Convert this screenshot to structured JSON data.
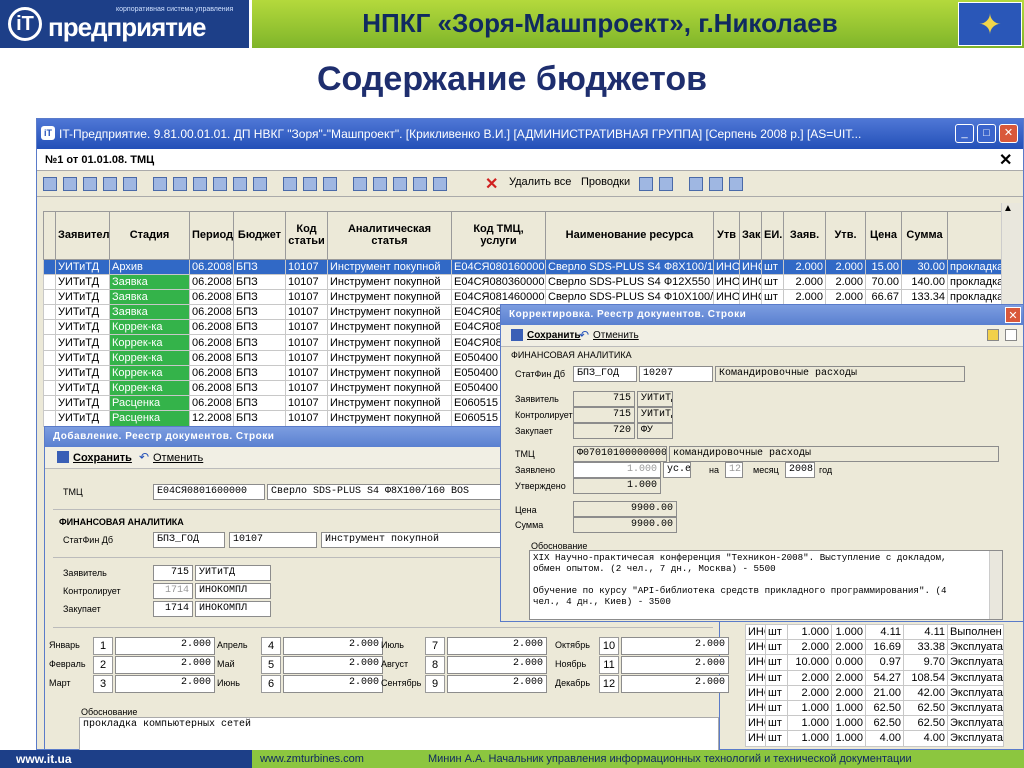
{
  "header": {
    "logo_small": "корпоративная система управления",
    "logo_big": "предприятие",
    "logo_mark": "iT",
    "title": "НПКГ «Зоря-Машпроект», г.Николаев"
  },
  "subtitle": "Содержание бюджетов",
  "window": {
    "title": "IT-Предприятие. 9.81.00.01.01. ДП НВКГ \"Зоря\"-\"Машпроект\". [Крикливенко В.И.] [АДМИНИСТРАТИВНАЯ ГРУППА] [Серпень 2008 р.] [AS=UIT...",
    "doc_title": "№1 от 01.01.08. ТМЦ",
    "close": "✕"
  },
  "toolbar": {
    "delete_all": "Удалить все",
    "postings": "Проводки"
  },
  "grid": {
    "columns": [
      "Заявитель",
      "Стадия",
      "Период",
      "Бюджет",
      "Код статьи",
      "Аналитическая статья",
      "Код ТМЦ, услуги",
      "Наименование ресурса",
      "Утв",
      "Зак",
      "ЕИ.",
      "Заяв.",
      "Утв.",
      "Цена",
      "Сумма",
      ""
    ],
    "rows": [
      [
        "УИТиТД",
        "Архив",
        "06.2008",
        "БПЗ",
        "10107",
        "Инструмент покупной",
        "E04CЯ0801600000",
        "Сверло SDS-PLUS S4 Ф8X100/160 E",
        "ИНО",
        "ИНО",
        "шт",
        "2.000",
        "2.000",
        "15.00",
        "30.00",
        "прокладка"
      ],
      [
        "УИТиТД",
        "Заявка",
        "06.2008",
        "БПЗ",
        "10107",
        "Инструмент покупной",
        "E04CЯ0803600000",
        "Сверло SDS-PLUS S4 Ф12X550 BOS",
        "ИНО",
        "ИНО",
        "шт",
        "2.000",
        "2.000",
        "70.00",
        "140.00",
        "прокладка"
      ],
      [
        "УИТиТД",
        "Заявка",
        "06.2008",
        "БПЗ",
        "10107",
        "Инструмент покупной",
        "E04CЯ0814600000",
        "Сверло SDS-PLUS S4 Ф10X100/160",
        "ИНО",
        "ИНО",
        "шт",
        "2.000",
        "2.000",
        "66.67",
        "133.34",
        "прокладка"
      ],
      [
        "УИТиТД",
        "Заявка",
        "06.2008",
        "БПЗ",
        "10107",
        "Инструмент покупной",
        "E04CЯ082",
        "",
        "",
        "",
        "",
        "",
        "",
        "",
        "",
        ""
      ],
      [
        "УИТиТД",
        "Коррек-ка",
        "06.2008",
        "БПЗ",
        "10107",
        "Инструмент покупной",
        "E04CЯ082",
        "",
        "",
        "",
        "",
        "",
        "",
        "",
        "",
        ""
      ],
      [
        "УИТиТД",
        "Коррек-ка",
        "06.2008",
        "БПЗ",
        "10107",
        "Инструмент покупной",
        "E04CЯ084",
        "",
        "",
        "",
        "",
        "",
        "",
        "",
        "",
        ""
      ],
      [
        "УИТиТД",
        "Коррек-ка",
        "06.2008",
        "БПЗ",
        "10107",
        "Инструмент покупной",
        "E050400",
        "",
        "",
        "",
        "",
        "",
        "",
        "",
        "",
        ""
      ],
      [
        "УИТиТД",
        "Коррек-ка",
        "06.2008",
        "БПЗ",
        "10107",
        "Инструмент покупной",
        "E050400",
        "",
        "",
        "",
        "",
        "",
        "",
        "",
        "",
        ""
      ],
      [
        "УИТиТД",
        "Коррек-ка",
        "06.2008",
        "БПЗ",
        "10107",
        "Инструмент покупной",
        "E050400",
        "",
        "",
        "",
        "",
        "",
        "",
        "",
        "",
        ""
      ],
      [
        "УИТиТД",
        "Расценка",
        "06.2008",
        "БПЗ",
        "10107",
        "Инструмент покупной",
        "E060515",
        "",
        "",
        "",
        "",
        "",
        "",
        "",
        "",
        ""
      ],
      [
        "УИТиТД",
        "Расценка",
        "12.2008",
        "БПЗ",
        "10107",
        "Инструмент покупной",
        "E060515",
        "",
        "",
        "",
        "",
        "",
        "",
        "",
        "",
        ""
      ]
    ],
    "lower_rows": [
      [
        "ИНО",
        "шт",
        "1.000",
        "1.000",
        "4.11",
        "4.11",
        "Выполнен"
      ],
      [
        "ИНО",
        "шт",
        "2.000",
        "2.000",
        "16.69",
        "33.38",
        "Эксплуата"
      ],
      [
        "ИНО",
        "шт",
        "10.000",
        "0.000",
        "0.97",
        "9.70",
        "Эксплуата"
      ],
      [
        "ИНО",
        "шт",
        "2.000",
        "2.000",
        "54.27",
        "108.54",
        "Эксплуата"
      ],
      [
        "ИНО",
        "шт",
        "2.000",
        "2.000",
        "21.00",
        "42.00",
        "Эксплуата"
      ],
      [
        "ИНО",
        "шт",
        "1.000",
        "1.000",
        "62.50",
        "62.50",
        "Эксплуата"
      ],
      [
        "ИНО",
        "шт",
        "1.000",
        "1.000",
        "62.50",
        "62.50",
        "Эксплуата"
      ],
      [
        "ИНО",
        "шт",
        "1.000",
        "1.000",
        "4.00",
        "4.00",
        "Эксплуата"
      ]
    ]
  },
  "add_dialog": {
    "title": "Добавление. Реестр документов. Строки",
    "save": "Сохранить",
    "cancel": "Отменить",
    "tmc_label": "ТМЦ",
    "tmc_code": "E04CЯ0801600000",
    "tmc_name": "Сверло SDS-PLUS S4 Ф8X100/160 BOS",
    "fin_section": "ФИНАНСОВАЯ АНАЛИТИКА",
    "statfin_label": "СтатФин Дб",
    "statfin_code": "БПЗ_ГОД",
    "statfin_num": "10107",
    "statfin_name": "Инструмент покупной",
    "applicant_label": "Заявитель",
    "applicant_num": "715",
    "applicant_name": "УИТиТД",
    "controller_label": "Контролирует",
    "controller_num": "1714",
    "controller_name": "ИНОКОМПЛ",
    "buyer_label": "Закупает",
    "buyer_num": "1714",
    "buyer_name": "ИНОКОМПЛ",
    "months": [
      {
        "name": "Январь",
        "n": "1",
        "v": "2.000"
      },
      {
        "name": "Апрель",
        "n": "4",
        "v": "2.000"
      },
      {
        "name": "Июль",
        "n": "7",
        "v": "2.000"
      },
      {
        "name": "Октябрь",
        "n": "10",
        "v": "2.000"
      },
      {
        "name": "Февраль",
        "n": "2",
        "v": "2.000"
      },
      {
        "name": "Май",
        "n": "5",
        "v": "2.000"
      },
      {
        "name": "Август",
        "n": "8",
        "v": "2.000"
      },
      {
        "name": "Ноябрь",
        "n": "11",
        "v": "2.000"
      },
      {
        "name": "Март",
        "n": "3",
        "v": "2.000"
      },
      {
        "name": "Июнь",
        "n": "6",
        "v": "2.000"
      },
      {
        "name": "Сентябрь",
        "n": "9",
        "v": "2.000"
      },
      {
        "name": "Декабрь",
        "n": "12",
        "v": "2.000"
      }
    ],
    "basis_label": "Обоснование",
    "basis_text": "прокладка компьютерных сетей"
  },
  "corr_dialog": {
    "title": "Корректировка. Реестр документов. Строки",
    "save": "Сохранить",
    "cancel": "Отменить",
    "fin_section": "ФИНАНСОВАЯ АНАЛИТИКА",
    "statfin_label": "СтатФин Дб",
    "statfin_code": "БПЗ_ГОД",
    "statfin_num": "10207",
    "statfin_name": "Командировочные расходы",
    "applicant_label": "Заявитель",
    "applicant_num": "715",
    "applicant_name": "УИТиТД",
    "controller_label": "Контролирует",
    "controller_num": "715",
    "controller_name": "УИТиТД",
    "buyer_label": "Закупает",
    "buyer_num": "720",
    "buyer_name": "ФУ",
    "tmc_label": "ТМЦ",
    "tmc_code": "Ф07010100000000",
    "tmc_name": "командировочные расходы",
    "declared_label": "Заявлено",
    "declared_val": "1.000",
    "unit": "ус.е",
    "on_label": "на",
    "month_num": "12",
    "month_label": "месяц",
    "year": "2008",
    "year_label": "год",
    "approved_label": "Утверждено",
    "approved_val": "1.000",
    "price_label": "Цена",
    "price_val": "9900.00",
    "sum_label": "Сумма",
    "sum_val": "9900.00",
    "basis_label": "Обоснование",
    "basis_line1": "XIX Научно-практичесая конференция \"Техникон-2008\". Выступление с докладом,",
    "basis_line2": "обмен опытом. (2 чел., 7 дн., Москва) - 5500",
    "basis_line3": "Обучение по курсу \"API-библиотека средств прикладного программирования\". (4",
    "basis_line4": "чел., 4 дн., Киев) - 3500"
  },
  "footer": {
    "left": "www.it.ua",
    "site": "www.zmturbines.com",
    "author": "Минин А.А. Начальник управления информационных технологий и технической документации"
  }
}
